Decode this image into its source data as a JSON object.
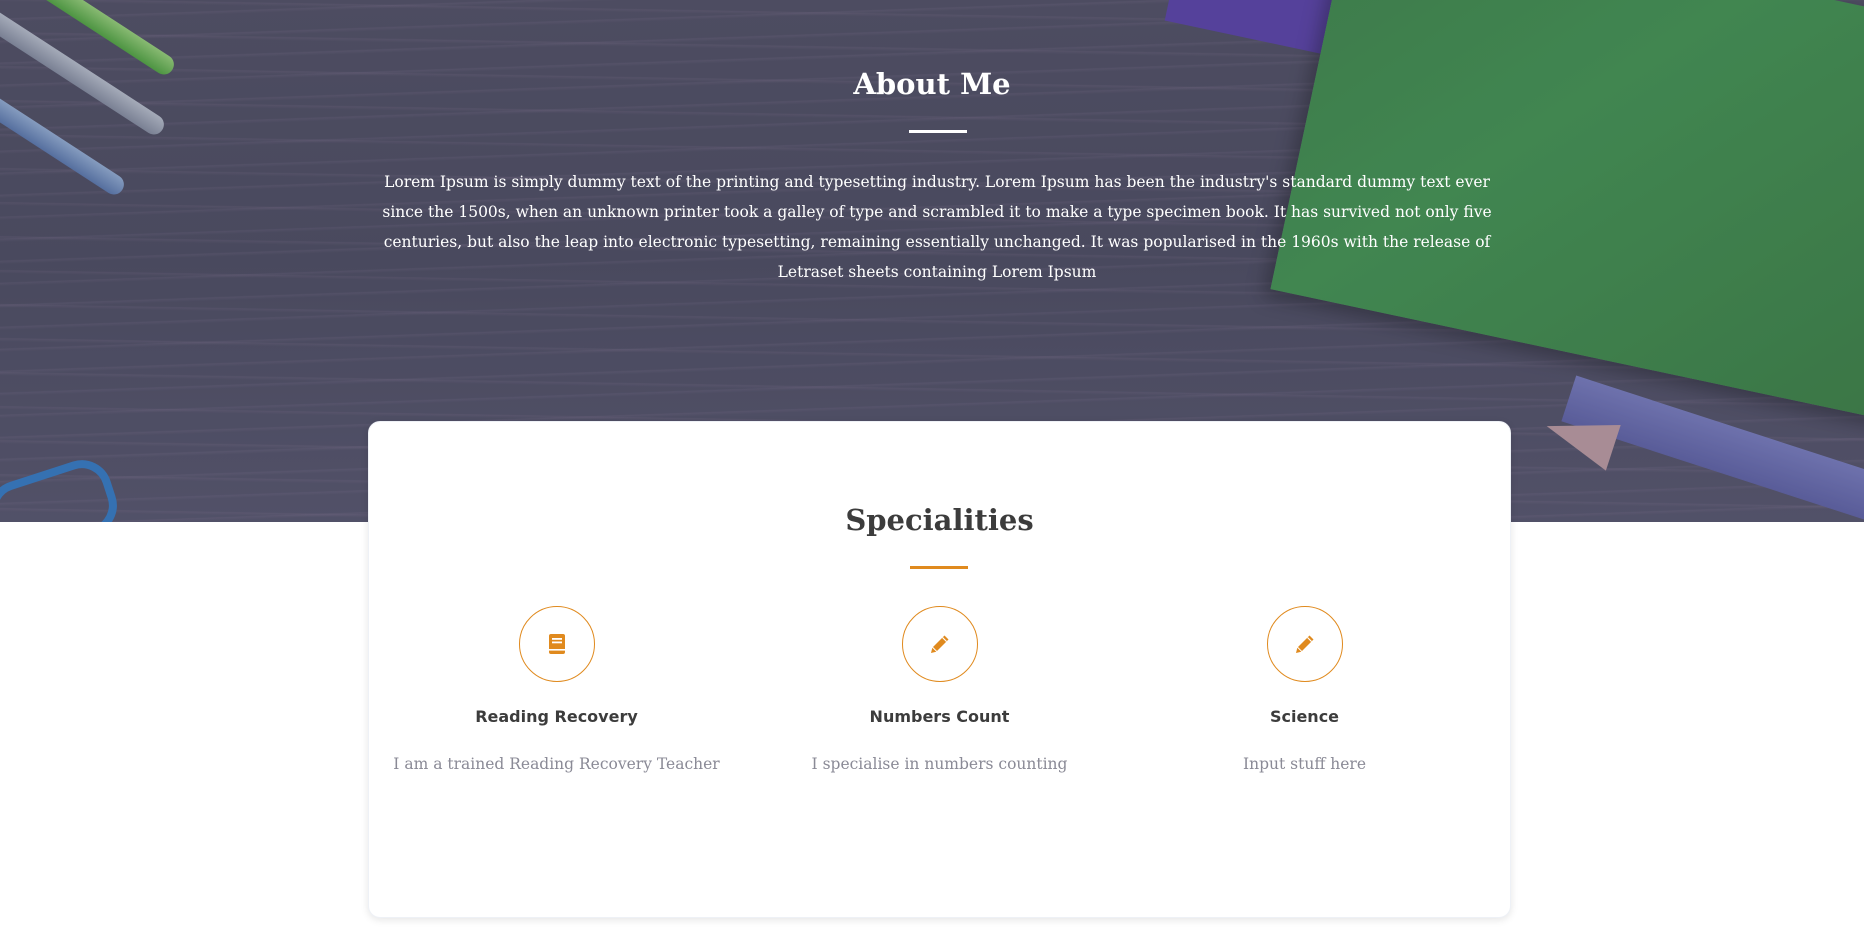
{
  "about": {
    "title": "About Me",
    "text": "Lorem Ipsum is simply dummy text of the printing and typesetting industry. Lorem Ipsum has been the industry's standard dummy text ever since the 1500s, when an unknown printer took a galley of type and scrambled it to make a type specimen book. It has survived not only five centuries, but also the leap into electronic typesetting, remaining essentially unchanged. It was popularised in the 1960s with the release of Letraset sheets containing Lorem Ipsum"
  },
  "specialities": {
    "title": "Specialities",
    "items": [
      {
        "icon": "book-icon",
        "title": "Reading Recovery",
        "description": "I am a trained Reading Recovery Teacher"
      },
      {
        "icon": "pencil-icon",
        "title": "Numbers Count",
        "description": "I specialise in numbers counting"
      },
      {
        "icon": "pencil-icon",
        "title": "Science",
        "description": "Input stuff here"
      }
    ]
  },
  "colors": {
    "accent": "#e08a1e",
    "heading_dark": "#3c3c3c",
    "muted_text": "#8a8a96",
    "hero_text": "#ffffff"
  }
}
